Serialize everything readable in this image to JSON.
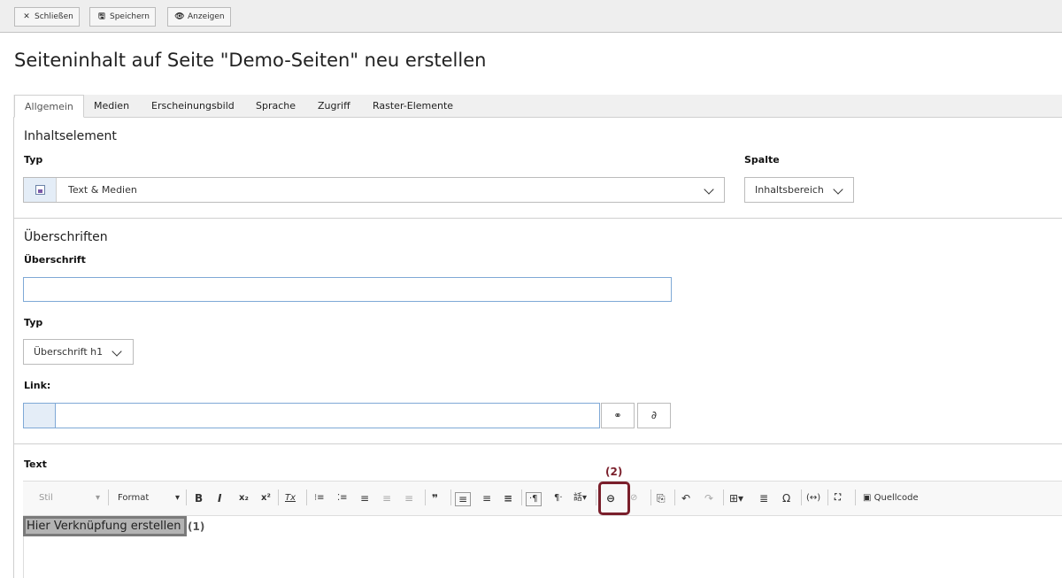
{
  "toolbar": {
    "close_label": "Schließen",
    "save_label": "Speichern",
    "view_label": "Anzeigen"
  },
  "page": {
    "title": "Seiteninhalt auf Seite \"Demo-Seiten\" neu erstellen"
  },
  "tabs": [
    {
      "label": "Allgemein",
      "active": true
    },
    {
      "label": "Medien"
    },
    {
      "label": "Erscheinungsbild"
    },
    {
      "label": "Sprache"
    },
    {
      "label": "Zugriff"
    },
    {
      "label": "Raster-Elemente"
    }
  ],
  "content_element": {
    "section_title": "Inhaltselement",
    "type_label": "Typ",
    "type_value": "Text & Medien",
    "column_label": "Spalte",
    "column_value": "Inhaltsbereich"
  },
  "headings": {
    "section_title": "Überschriften",
    "heading_label": "Überschrift",
    "heading_value": "",
    "type_label": "Typ",
    "type_value": "Überschrift h1",
    "link_label": "Link:",
    "link_value": ""
  },
  "text": {
    "label": "Text",
    "style_select": "Stil",
    "format_select": "Format",
    "source_button": "Quellcode",
    "body": "Hier Verknüpfung erstellen",
    "annotation_1": "(1)",
    "annotation_2": "(2)"
  },
  "icons": {
    "close": "close-icon",
    "save": "save-icon",
    "view": "eye-icon",
    "link_wizard": "link-wizard-icon",
    "unlink": "unlink-icon"
  },
  "colors": {
    "annotation": "#7a1f2b",
    "input_border": "#7fa9d6",
    "highlight": "#b3b3b3"
  }
}
